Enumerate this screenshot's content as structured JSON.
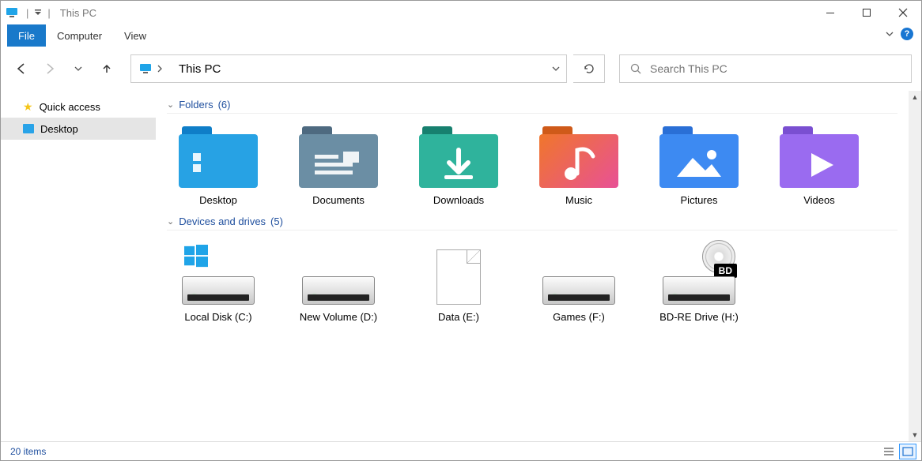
{
  "window": {
    "title": "This PC"
  },
  "ribbon": {
    "tabs": {
      "file": "File",
      "computer": "Computer",
      "view": "View"
    }
  },
  "nav": {
    "location": "This PC",
    "search_placeholder": "Search This PC"
  },
  "sidebar": {
    "items": [
      {
        "label": "Quick access"
      },
      {
        "label": "Desktop"
      }
    ]
  },
  "groups": [
    {
      "title": "Folders",
      "count": "(6)",
      "items": [
        {
          "label": "Desktop",
          "icon": "desktop"
        },
        {
          "label": "Documents",
          "icon": "documents"
        },
        {
          "label": "Downloads",
          "icon": "downloads"
        },
        {
          "label": "Music",
          "icon": "music"
        },
        {
          "label": "Pictures",
          "icon": "pictures"
        },
        {
          "label": "Videos",
          "icon": "videos"
        }
      ]
    },
    {
      "title": "Devices and drives",
      "count": "(5)",
      "items": [
        {
          "label": "Local Disk (C:)",
          "icon": "drive-win"
        },
        {
          "label": "New Volume (D:)",
          "icon": "drive"
        },
        {
          "label": "Data (E:)",
          "icon": "file"
        },
        {
          "label": "Games (F:)",
          "icon": "drive"
        },
        {
          "label": "BD-RE Drive (H:)",
          "icon": "optical"
        }
      ]
    }
  ],
  "status": {
    "text": "20 items"
  },
  "folder_colors": {
    "desktop": {
      "tab": "#0f7ec8",
      "body": "#27a2e4"
    },
    "documents": {
      "tab": "#4e6a80",
      "body": "#6b8ea4"
    },
    "downloads": {
      "tab": "#17806f",
      "body": "#2fb39c"
    },
    "music": {
      "tab": "#cf5a19",
      "body": "linear-gradient(135deg,#f0762b,#e85196)"
    },
    "pictures": {
      "tab": "#2a6fd6",
      "body": "#3d8af2"
    },
    "videos": {
      "tab": "#7a4fd1",
      "body": "#9a6bf0"
    }
  }
}
